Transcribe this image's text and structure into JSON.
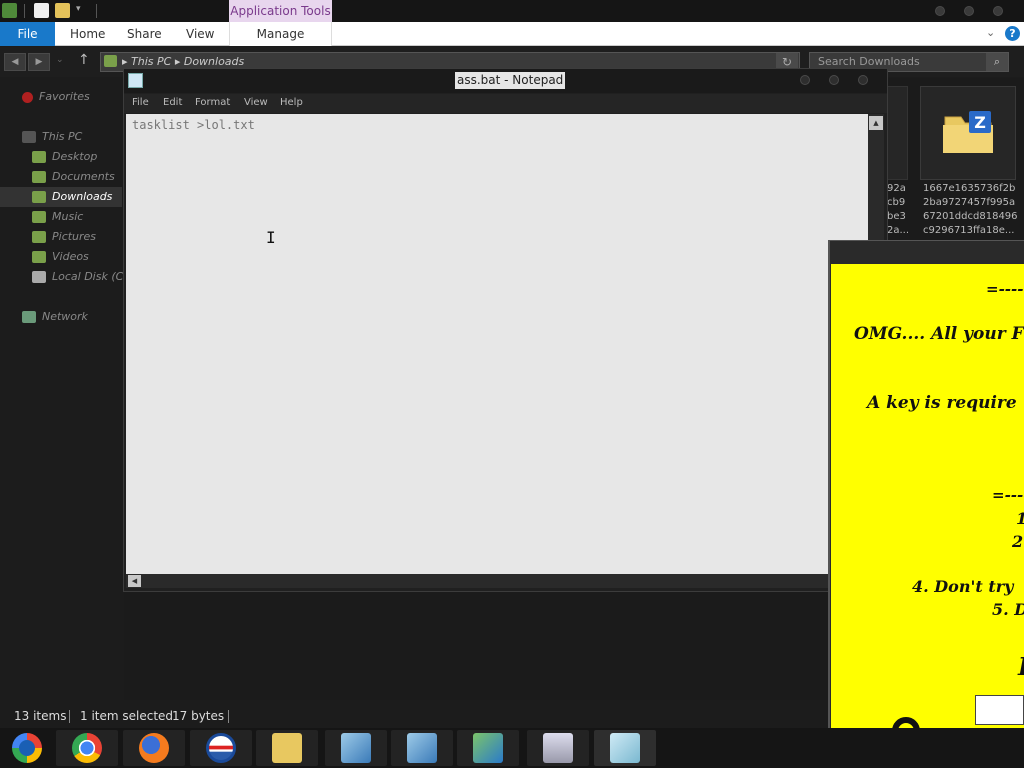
{
  "explorer": {
    "ribbon": {
      "context_group": "Application Tools",
      "tabs": [
        "File",
        "Home",
        "Share",
        "View",
        "Manage"
      ]
    },
    "address": {
      "segments": [
        "This PC",
        "Downloads"
      ]
    },
    "search": {
      "placeholder": "Search Downloads"
    },
    "sidebar": {
      "favorites": "Favorites",
      "this_pc": "This PC",
      "items": [
        "Desktop",
        "Documents",
        "Downloads",
        "Music",
        "Pictures",
        "Videos",
        "Local Disk (C:)"
      ],
      "network": "Network"
    },
    "files": {
      "partial_name_lines": [
        "92a",
        "cb9",
        "be3",
        "2a..."
      ],
      "selected_name_lines": [
        "1667e1635736f2b",
        "2ba9727457f995a",
        "67201ddcd818496",
        "c9296713ffa18e..."
      ]
    },
    "status": {
      "count": "13 items",
      "selection": "1 item selected",
      "size": "17 bytes"
    }
  },
  "notepad": {
    "title": "ass.bat - Notepad",
    "menu": [
      "File",
      "Edit",
      "Format",
      "View",
      "Help"
    ],
    "content": "tasklist >lol.txt"
  },
  "ransom_note": {
    "lines": [
      "=----",
      "OMG.... All your F",
      "A key is require",
      "=----",
      "1",
      "2",
      "4. Don't try",
      "5. D",
      "I"
    ],
    "background": "#ffff00"
  },
  "taskbar": {
    "apps": [
      "windows-start-icon",
      "chrome-icon",
      "firefox-icon",
      "obama-campaign-icon",
      "file-explorer-icon",
      "network-setup-icon",
      "network-setup-icon",
      "network-users-icon",
      "system-monitor-icon",
      "notepad-icon"
    ]
  }
}
